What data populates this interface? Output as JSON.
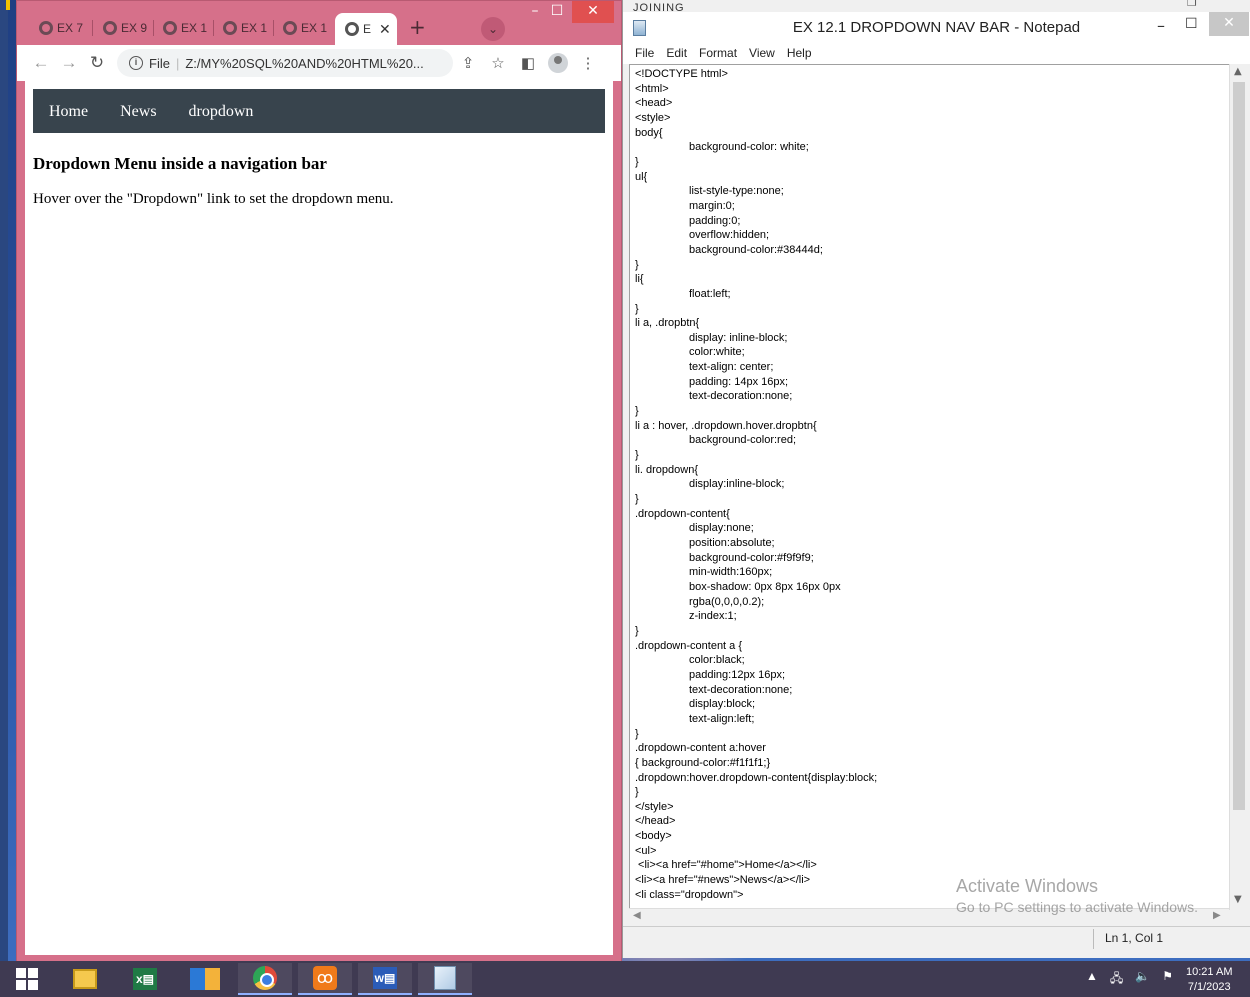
{
  "chrome": {
    "tabs": [
      {
        "label": "EX 7"
      },
      {
        "label": "EX 9"
      },
      {
        "label": "EX 1"
      },
      {
        "label": "EX 1"
      },
      {
        "label": "EX 1"
      }
    ],
    "active_tab": {
      "label": "E"
    },
    "address": "Z:/MY%20SQL%20AND%20HTML%20...",
    "address_prefix": "File",
    "page": {
      "nav_links": [
        "Home",
        "News",
        "dropdown"
      ],
      "heading": "Dropdown Menu inside a navigation bar",
      "text": "Hover over the \"Dropdown\" link to set the dropdown menu."
    }
  },
  "notepad": {
    "behind_title": "JOINING",
    "title": "EX 12.1 DROPDOWN NAV BAR - Notepad",
    "menu": [
      "File",
      "Edit",
      "Format",
      "View",
      "Help"
    ],
    "code_lines": [
      "<!DOCTYPE html>",
      "<html>",
      "<head>",
      "<style>",
      "body{",
      "\t\tbackground-color: white;",
      "}",
      "ul{",
      "\t\tlist-style-type:none;",
      "\t\tmargin:0;",
      "\t\tpadding:0;",
      "\t\toverflow:hidden;",
      "\t\tbackground-color:#38444d;",
      "}",
      "li{",
      "\t\tfloat:left;",
      "}",
      "li a, .dropbtn{",
      "\t\tdisplay: inline-block;",
      "\t\tcolor:white;",
      "\t\ttext-align: center;",
      "\t\tpadding: 14px 16px;",
      "\t\ttext-decoration:none;",
      "}",
      "li a : hover, .dropdown.hover.dropbtn{",
      "\t\tbackground-color:red;",
      "}",
      "li. dropdown{",
      "\t\tdisplay:inline-block;",
      "}",
      ".dropdown-content{",
      "\t\tdisplay:none;",
      "\t\tposition:absolute;",
      "\t\tbackground-color:#f9f9f9;",
      "\t\tmin-width:160px;",
      "\t\tbox-shadow: 0px 8px 16px 0px",
      "\t\trgba(0,0,0,0.2);",
      "\t\tz-index:1;",
      "}",
      ".dropdown-content a {",
      "\t\tcolor:black;",
      "\t\tpadding:12px 16px;",
      "\t\ttext-decoration:none;",
      "\t\tdisplay:block;",
      "\t\ttext-align:left;",
      "}",
      ".dropdown-content a:hover",
      "{ background-color:#f1f1f1;}",
      ".dropdown:hover.dropdown-content{display:block;",
      "}",
      "</style>",
      "</head>",
      "<body>",
      "<ul>",
      " <li><a href=\"#home\">Home</a></li>",
      "<li><a href=\"#news\">News</a></li>",
      "<li class=\"dropdown\">"
    ],
    "status_position": "Ln 1, Col 1"
  },
  "watermark": {
    "title": "Activate Windows",
    "subtitle": "Go to PC settings to activate Windows."
  },
  "taskbar": {
    "clock_time": "10:21 AM",
    "clock_date": "7/1/2023"
  }
}
